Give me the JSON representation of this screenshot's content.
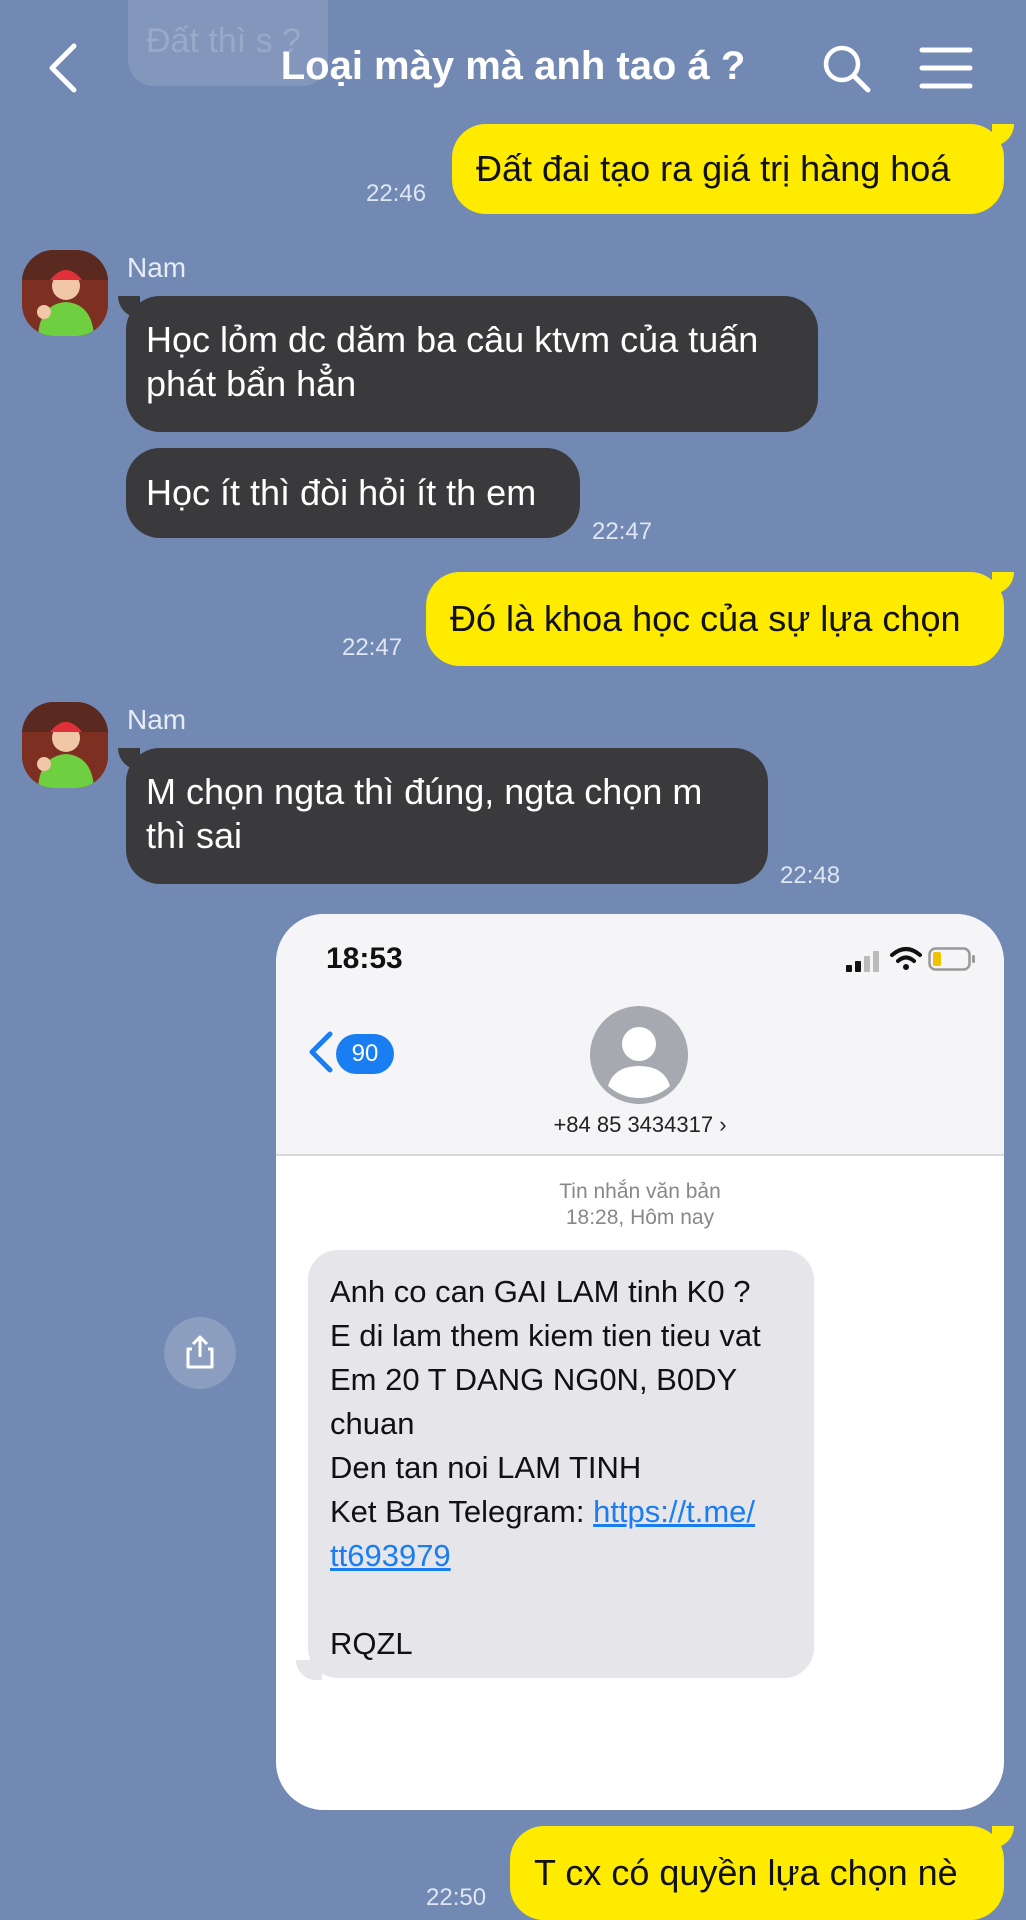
{
  "header": {
    "faded_text": "Đất thì s ?",
    "title": "Loại mày mà anh tao á ?"
  },
  "messages": [
    {
      "id": "m1",
      "side": "me",
      "text": "Đất đai tạo ra giá trị hàng hoá",
      "time": "22:46"
    },
    {
      "id": "m2",
      "side": "them",
      "sender": "Nam",
      "lines": [
        "Học lỏm dc dăm ba câu ktvm của tuấn",
        "phát bẩn hẳn"
      ]
    },
    {
      "id": "m3",
      "side": "them",
      "text": "Học ít thì đòi hỏi ít th em",
      "time": "22:47"
    },
    {
      "id": "m4",
      "side": "me",
      "text": "Đó là khoa học của sự lựa chọn",
      "time": "22:47"
    },
    {
      "id": "m5",
      "side": "them",
      "sender": "Nam",
      "lines": [
        "M chọn ngta thì đúng, ngta chọn m",
        "thì sai"
      ],
      "time": "22:48"
    },
    {
      "id": "m7",
      "side": "me",
      "text": "T cx có quyền lựa chọn nè",
      "time": "22:50"
    }
  ],
  "image_message": {
    "status_time": "18:53",
    "back_badge": "90",
    "phone": "+84 85 3434317 ›",
    "meta_line1": "Tin nhắn văn bản",
    "meta_line2": "18:28, Hôm nay",
    "sms_lines": [
      "Anh co can GAI LAM tinh K0 ?",
      "E di lam them kiem tien tieu vat",
      "Em 20 T DANG NG0N, B0DY",
      "chuan",
      "Den tan noi LAM TINH"
    ],
    "sms_link_prefix": "Ket Ban Telegram: ",
    "sms_link_part1": "https://t.me/",
    "sms_link_part2": "tt693979",
    "sms_code": "RQZL"
  },
  "colors": {
    "background": "#7289b3",
    "my_bubble": "#ffeb00",
    "their_bubble": "#3a3a3c",
    "link": "#1a7ef3"
  },
  "icons": [
    "chevron-left-icon",
    "search-icon",
    "menu-icon",
    "share-icon",
    "signal-icon",
    "wifi-icon",
    "battery-icon",
    "person-icon"
  ]
}
